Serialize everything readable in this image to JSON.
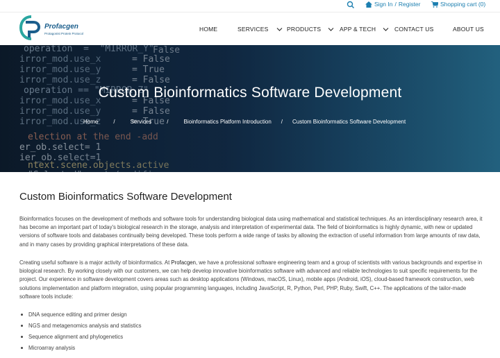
{
  "topbar": {
    "signin_label": "Sign In",
    "register_label": "Register",
    "separator": "/",
    "cart_label": "Shopping cart (0)"
  },
  "brand": {
    "name": "Profacgen",
    "tagline": "Protagonist Protein Protocol",
    "primary_color": "#1b5e8c",
    "accent_color": "#2aa6a0"
  },
  "nav": {
    "home": "HOME",
    "services": "SERVICES",
    "products": "PRODUCTS",
    "app_tech": "APP & TECH",
    "contact": "CONTACT US",
    "about": "ABOUT US"
  },
  "hero": {
    "title": "Custom Bioinformatics Software Development",
    "breadcrumbs": [
      "Home",
      "Services",
      "Bioinformatics Platform Introduction",
      "Custom Bioinformatics Software Development"
    ],
    "crumb_sep": "/"
  },
  "content": {
    "heading": "Custom Bioinformatics Software Development",
    "paragraph1": "Bioinformatics focuses on the development of methods and software tools for understanding biological data using mathematical and statistical techniques. As an interdisciplinary research area, it has become an important part of today's biological research in the storage, analysis and interpretation of experimental data. The field of bioinformatics is highly dynamic, with new or updated versions of software tools and databases continually being developed. These tools perform a wide range of tasks by allowing the extraction of useful information from large amounts of raw data, and in many cases by providing graphical interpretations of these data.",
    "paragraph2_before": "Creating useful software is a major activity of bioinformatics. At ",
    "paragraph2_brand": "Profacgen",
    "paragraph2_after": ", we have a professional software engineering team and a group of scientists with various backgrounds and expertise in biological research. By working closely with our customers, we can help develop innovative bioinformatics software with advanced and reliable technologies to suit specific requirements for the project. Our experience in software development covers areas such as desktop applications (Windows, macOS, Linux), mobile apps (Android, iOS), cloud-based framework construction, web solutions implementation and platform integration, using popular programming languages, including JavaScript, R, Python, Perl, PHP, Ruby, Swift, C++. The applications of the tailor-made software tools include:",
    "bullets": [
      "DNA sequence editing and primer design",
      "NGS and metagenomics analysis and statistics",
      "Sequence alignment and phylogenetics",
      "Microarray analysis"
    ]
  }
}
